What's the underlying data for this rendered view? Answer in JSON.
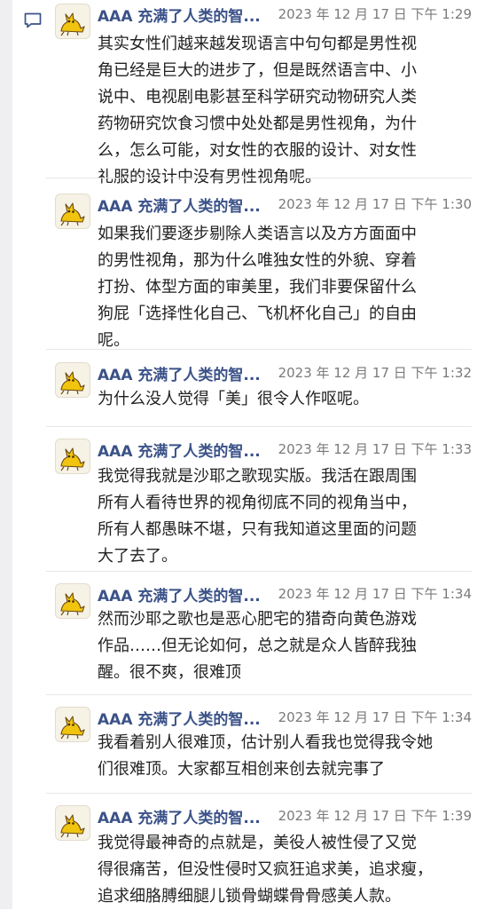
{
  "icons": {
    "comment": "comment-icon",
    "avatar": "yellow-cat-avatar"
  },
  "colors": {
    "username": "#3b5288",
    "timestamp": "#7a7a7a",
    "body_text": "#222222",
    "side_rail": "#efeff1"
  },
  "messages": [
    {
      "username": "AAA 充满了人类的智...",
      "timestamp": "2023 年 12 月 17 日 下午 1:29",
      "lines": [
        "其实女性们越来越发现语言中句句都是男性视",
        "角已经是巨大的进步了，但是既然语言中、小",
        "说中、电视剧电影甚至科学研究动物研究人类",
        "药物研究饮食习惯中处处都是男性视角，为什",
        "么，怎么可能，对女性的衣服的设计、对女性",
        "礼服的设计中没有男性视角呢。"
      ]
    },
    {
      "username": "AAA 充满了人类的智...",
      "timestamp": "2023 年 12 月 17 日 下午 1:30",
      "lines": [
        "如果我们要逐步剔除人类语言以及方方面面中",
        "的男性视角，那为什么唯独女性的外貌、穿着",
        "打扮、体型方面的审美里，我们非要保留什么",
        "狗屁「选择性化自己、飞机杯化自己」的自由",
        "呢。"
      ]
    },
    {
      "username": "AAA 充满了人类的智...",
      "timestamp": "2023 年 12 月 17 日 下午 1:32",
      "lines": [
        "为什么没人觉得「美」很令人作呕呢。"
      ]
    },
    {
      "username": "AAA 充满了人类的智...",
      "timestamp": "2023 年 12 月 17 日 下午 1:33",
      "lines": [
        "我觉得我就是沙耶之歌现实版。我活在跟周围",
        "所有人看待世界的视角彻底不同的视角当中，",
        "所有人都愚昧不堪，只有我知道这里面的问题",
        "大了去了。"
      ]
    },
    {
      "username": "AAA 充满了人类的智...",
      "timestamp": "2023 年 12 月 17 日 下午 1:34",
      "lines": [
        "然而沙耶之歌也是恶心肥宅的猎奇向黄色游戏",
        "作品……但无论如何，总之就是众人皆醉我独",
        "醒。很不爽，很难顶"
      ]
    },
    {
      "username": "AAA 充满了人类的智...",
      "timestamp": "2023 年 12 月 17 日 下午 1:34",
      "lines": [
        "我看着别人很难顶，估计别人看我也觉得我令她",
        "们很难顶。大家都互相创来创去就完事了"
      ]
    },
    {
      "username": "AAA 充满了人类的智...",
      "timestamp": "2023 年 12 月 17 日 下午 1:39",
      "lines": [
        "我觉得最神奇的点就是，美役人被性侵了又觉",
        "得很痛苦，但没性侵时又疯狂追求美，追求瘦，",
        "追求细胳膊细腿儿锁骨蝴蝶骨骨感美人款。"
      ]
    }
  ]
}
